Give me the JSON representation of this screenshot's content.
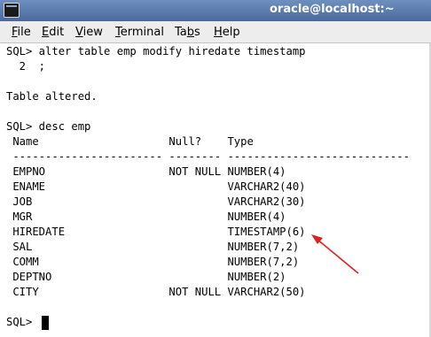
{
  "window": {
    "title": "oracle@localhost:~"
  },
  "menu": {
    "items": [
      {
        "mnemonic": "F",
        "rest": "ile"
      },
      {
        "mnemonic": "E",
        "rest": "dit"
      },
      {
        "mnemonic": "V",
        "rest": "iew"
      },
      {
        "mnemonic": "T",
        "rest": "erminal"
      },
      {
        "pre": "Ta",
        "mnemonic": "b",
        "rest": "s"
      },
      {
        "mnemonic": "H",
        "rest": "elp"
      }
    ]
  },
  "terminal": {
    "lines": [
      "SQL> alter table emp modify hiredate timestamp",
      "  2  ;",
      "",
      "Table altered.",
      "",
      "SQL> desc emp",
      " Name                    Null?    Type",
      " ----------------------- -------- ----------------------------",
      " EMPNO                   NOT NULL NUMBER(4)",
      " ENAME                            VARCHAR2(40)",
      " JOB                              VARCHAR2(30)",
      " MGR                              NUMBER(4)",
      " HIREDATE                         TIMESTAMP(6)",
      " SAL                              NUMBER(7,2)",
      " COMM                             NUMBER(7,2)",
      " DEPTNO                           NUMBER(2)",
      " CITY                    NOT NULL VARCHAR2(50)",
      "",
      "SQL> "
    ]
  },
  "annotation": {
    "arrow_color": "#e02020",
    "points_to": "TIMESTAMP(6)"
  }
}
